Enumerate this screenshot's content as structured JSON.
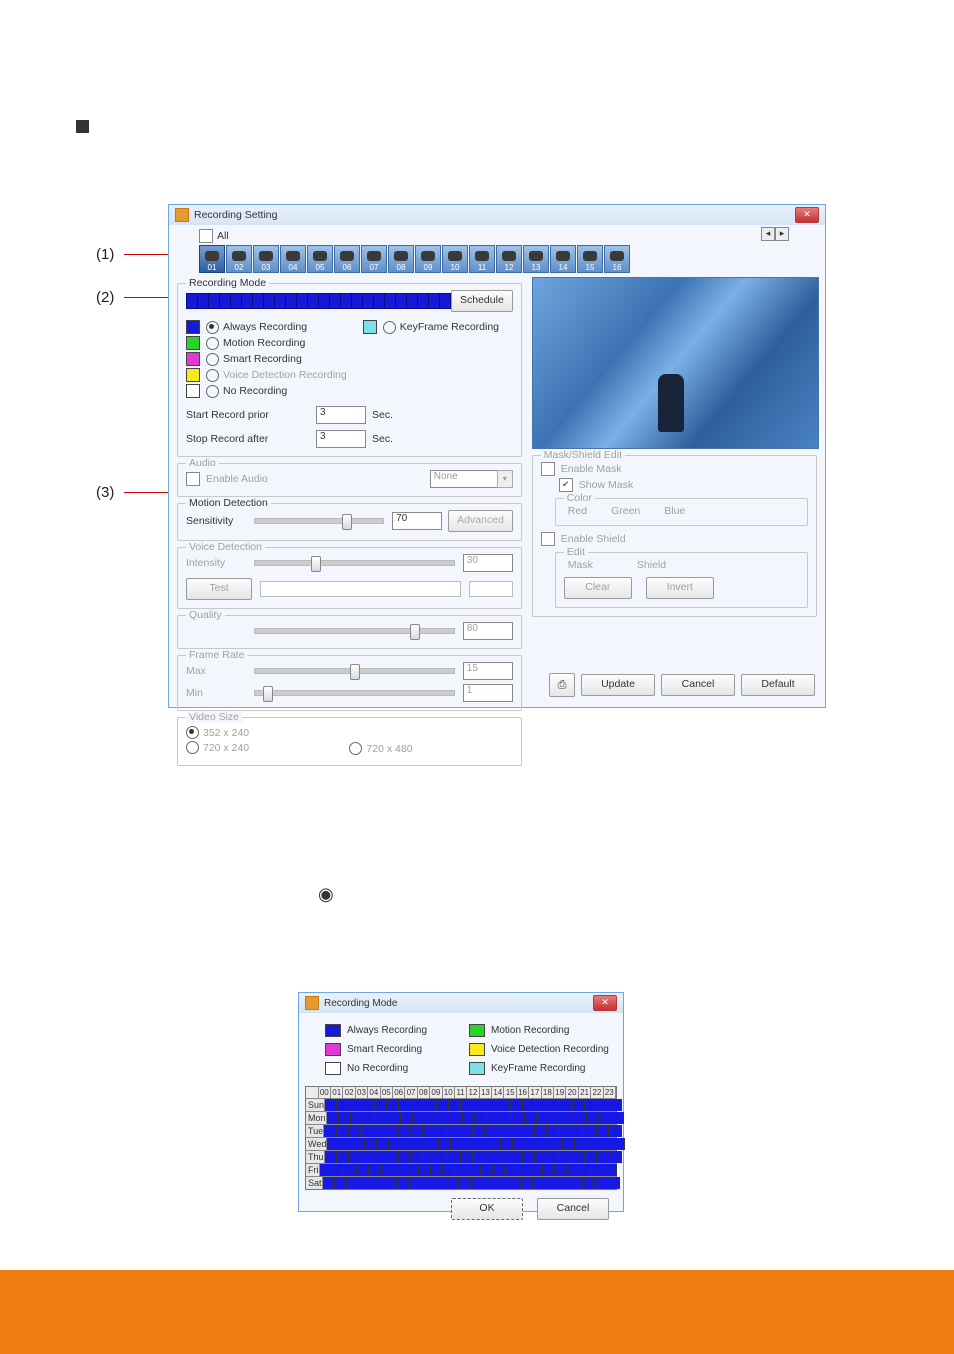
{
  "bullet": "■",
  "main": {
    "title": "Recording Setting",
    "close_tooltip": "Close",
    "all_label": "All",
    "cameras": [
      "01",
      "02",
      "03",
      "04",
      "05",
      "06",
      "07",
      "08",
      "09",
      "10",
      "11",
      "12",
      "13",
      "14",
      "15",
      "16"
    ],
    "recording_mode": {
      "legend": "Recording Mode",
      "schedule_btn": "Schedule",
      "options": {
        "always": {
          "label": "Always Recording",
          "color": "#1818d8",
          "selected": true
        },
        "keyframe": {
          "label": "KeyFrame Recording",
          "color": "#7de0e6"
        },
        "motion": {
          "label": "Motion Recording",
          "color": "#27d427"
        },
        "smart": {
          "label": "Smart Recording",
          "color": "#e338d2"
        },
        "voice": {
          "label": "Voice Detection Recording",
          "color": "#f7e91e",
          "disabled": true
        },
        "no": {
          "label": "No Recording",
          "color": "#ffffff"
        }
      },
      "start_prior": {
        "label": "Start Record prior",
        "value": "3",
        "unit": "Sec."
      },
      "stop_after": {
        "label": "Stop Record after",
        "value": "3",
        "unit": "Sec."
      }
    },
    "audio": {
      "legend": "Audio",
      "enable_label": "Enable Audio",
      "dropdown": "None"
    },
    "motion_detection": {
      "legend": "Motion Detection",
      "sensitivity_label": "Sensitivity",
      "value": "70",
      "advanced_btn": "Advanced"
    },
    "voice_detection": {
      "legend": "Voice Detection",
      "intensity_label": "Intensity",
      "value": "30",
      "test_btn": "Test"
    },
    "quality": {
      "legend": "Quality",
      "value": "80"
    },
    "frame_rate": {
      "legend": "Frame Rate",
      "max_label": "Max",
      "max_value": "15",
      "min_label": "Min",
      "min_value": "1"
    },
    "video_size": {
      "legend": "Video Size",
      "o1": "352 x 240",
      "o2": "720 x 240",
      "o3": "720 x 480"
    },
    "mask": {
      "legend": "Mask/Shield Edit",
      "enable_mask": "Enable Mask",
      "show_mask": "Show Mask",
      "color_legend": "Color",
      "red": "Red",
      "green": "Green",
      "blue": "Blue",
      "enable_shield": "Enable Shield",
      "edit_legend": "Edit",
      "mask_label": "Mask",
      "shield_label": "Shield",
      "clear_btn": "Clear",
      "invert_btn": "Invert"
    },
    "buttons": {
      "update": "Update",
      "cancel": "Cancel",
      "default": "Default"
    }
  },
  "annotations": {
    "a1": "(1)",
    "a2": "(2)",
    "a3": "(3)"
  },
  "radiosym": "◉",
  "sched": {
    "title": "Recording Mode",
    "legend": [
      {
        "label": "Always Recording",
        "color": "#1818d8"
      },
      {
        "label": "Motion Recording",
        "color": "#27d427"
      },
      {
        "label": "Smart Recording",
        "color": "#e338d2"
      },
      {
        "label": "Voice Detection Recording",
        "color": "#f7e91e"
      },
      {
        "label": "No Recording",
        "color": "#ffffff"
      },
      {
        "label": "KeyFrame Recording",
        "color": "#7de0e6"
      }
    ],
    "hours": [
      "00",
      "01",
      "02",
      "03",
      "04",
      "05",
      "06",
      "07",
      "08",
      "09",
      "10",
      "11",
      "12",
      "13",
      "14",
      "15",
      "16",
      "17",
      "18",
      "19",
      "20",
      "21",
      "22",
      "23"
    ],
    "days": [
      "Sun",
      "Mon",
      "Tue",
      "Wed",
      "Thu",
      "Fri",
      "Sat"
    ],
    "ok": "OK",
    "cancel": "Cancel"
  }
}
